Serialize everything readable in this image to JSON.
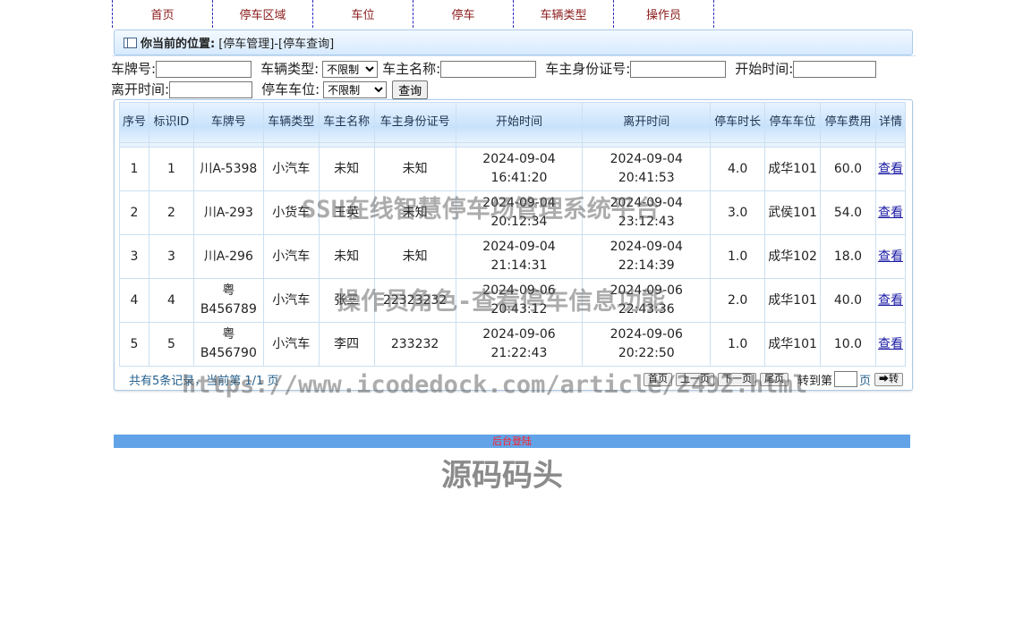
{
  "nav": [
    "首页",
    "停车区域",
    "车位",
    "停车",
    "车辆类型",
    "操作员"
  ],
  "breadcrumb": {
    "label": "你当前的位置:",
    "path": "[停车管理]-[停车查询]"
  },
  "search": {
    "plate_label": "车牌号:",
    "vehicle_type_label": "车辆类型:",
    "vehicle_type_value": "不限制",
    "owner_name_label": "车主名称:",
    "owner_id_label": "车主身份证号:",
    "start_time_label": "开始时间:",
    "end_time_label": "离开时间:",
    "space_label": "停车车位:",
    "space_value": "不限制",
    "query_button": "查询"
  },
  "table": {
    "headers": [
      "序号",
      "标识ID",
      "车牌号",
      "车辆类型",
      "车主名称",
      "车主身份证号",
      "开始时间",
      "离开时间",
      "停车时长",
      "停车车位",
      "停车费用",
      "详情"
    ],
    "rows": [
      [
        "1",
        "1",
        "川A-5398",
        "小汽车",
        "未知",
        "未知",
        "2024-09-04 16:41:20",
        "2024-09-04 20:41:53",
        "4.0",
        "成华101",
        "60.0",
        "查看"
      ],
      [
        "2",
        "2",
        "川A-293",
        "小货车",
        "王英",
        "未知",
        "2024-09-04 20:12:34",
        "2024-09-04 23:12:43",
        "3.0",
        "武侯101",
        "54.0",
        "查看"
      ],
      [
        "3",
        "3",
        "川A-296",
        "小汽车",
        "未知",
        "未知",
        "2024-09-04 21:14:31",
        "2024-09-04 22:14:39",
        "1.0",
        "成华102",
        "18.0",
        "查看"
      ],
      [
        "4",
        "4",
        "粤B456789",
        "小汽车",
        "张三",
        "22323232",
        "2024-09-06 20:43:12",
        "2024-09-06 22:43:36",
        "2.0",
        "成华101",
        "40.0",
        "查看"
      ],
      [
        "5",
        "5",
        "粤B456790",
        "小汽车",
        "李四",
        "233232",
        "2024-09-06 21:22:43",
        "2024-09-06 20:22:50",
        "1.0",
        "成华101",
        "10.0",
        "查看"
      ]
    ]
  },
  "pager": {
    "info": "共有5条记录，当前第 1/1 页",
    "first": "首页",
    "prev": "上一页",
    "next": "下一页",
    "last": "尾页",
    "goto_label": "转到第",
    "page_unit": "页",
    "go_button": "➡转"
  },
  "footer": {
    "link": "后台登陆"
  },
  "watermarks": {
    "line1": "SSH在线智慧停车场管理系统平台",
    "line2": "操作员角色-查看停车信息功能",
    "line3": "https://www.icodedock.com/article/2492.html",
    "line4": "源码码头"
  }
}
